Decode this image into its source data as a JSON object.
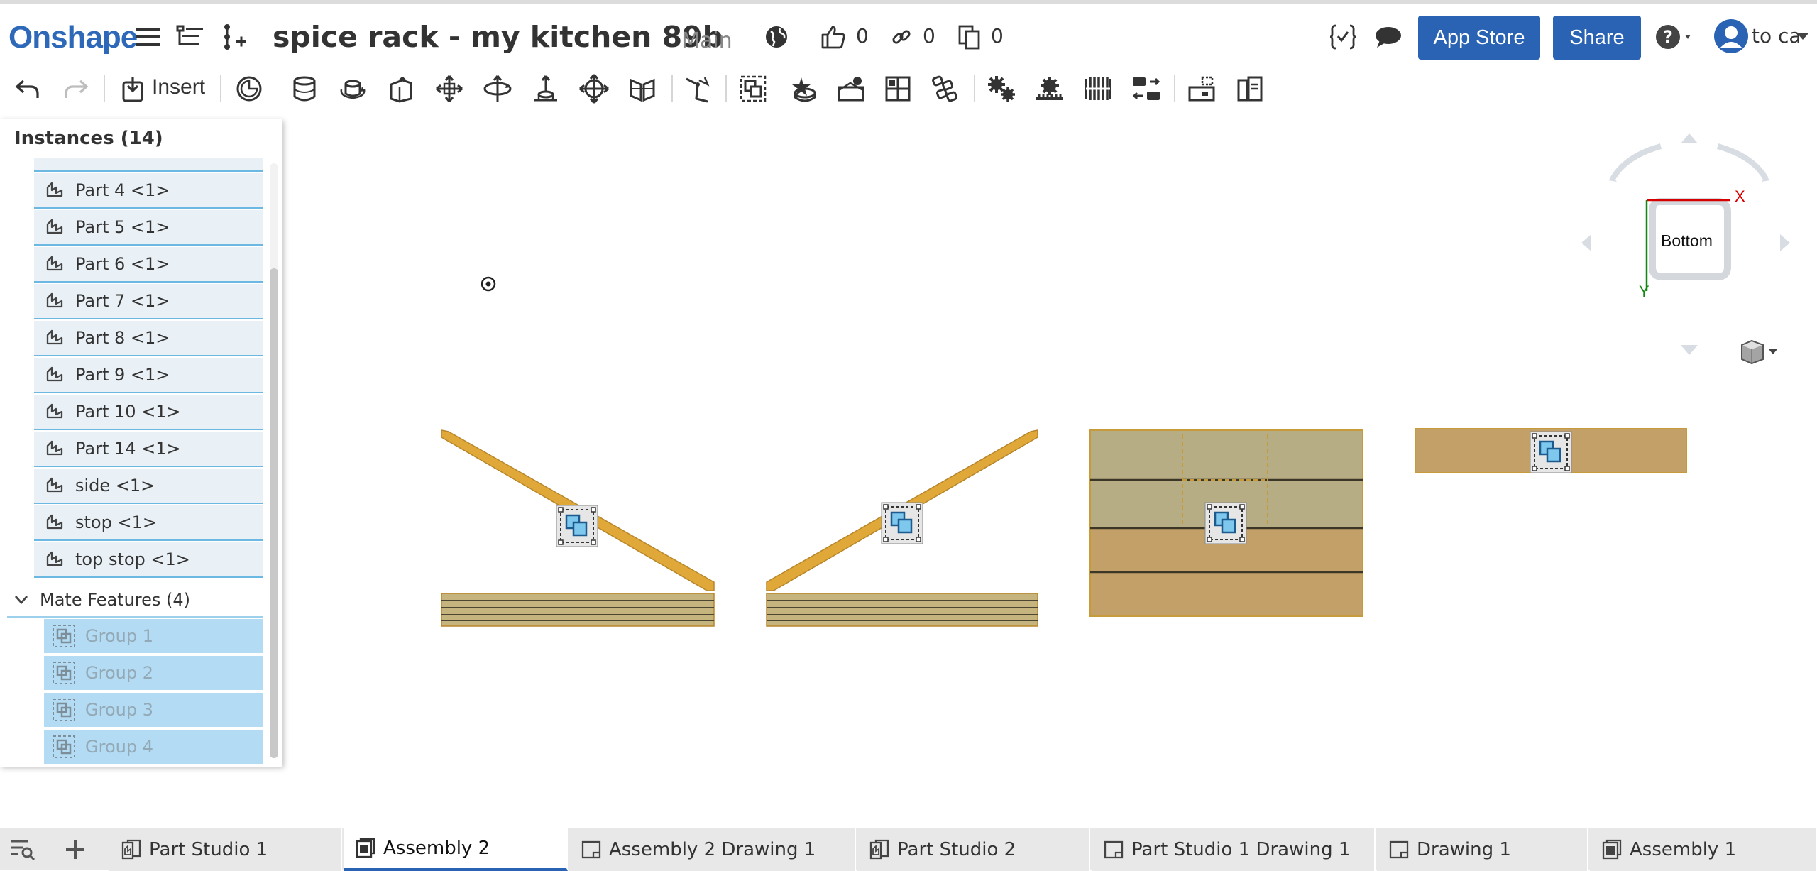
{
  "header": {
    "logo": "Onshape",
    "document_title": "spice rack - my kitchen 89b",
    "branch": "Main",
    "likes_count": "0",
    "links_count": "0",
    "copies_count": "0",
    "app_store_label": "App Store",
    "share_label": "Share",
    "user_name": "to ca"
  },
  "toolbar": {
    "insert_label": "Insert"
  },
  "panel": {
    "title": "Instances (14)",
    "instances": [
      {
        "label": "Part 4 <1>"
      },
      {
        "label": "Part 5 <1>"
      },
      {
        "label": "Part 6 <1>"
      },
      {
        "label": "Part 7 <1>"
      },
      {
        "label": "Part 8 <1>"
      },
      {
        "label": "Part 9 <1>"
      },
      {
        "label": "Part 10 <1>"
      },
      {
        "label": "Part 14 <1>"
      },
      {
        "label": "side <1>"
      },
      {
        "label": "stop <1>"
      },
      {
        "label": "top stop <1>"
      }
    ],
    "mate_features_label": "Mate Features (4)",
    "groups": [
      {
        "label": "Group 1"
      },
      {
        "label": "Group 2"
      },
      {
        "label": "Group 3"
      },
      {
        "label": "Group 4"
      }
    ]
  },
  "viewcube": {
    "face_label": "Bottom",
    "x_label": "X",
    "y_label": "Y"
  },
  "tabs": [
    {
      "label": "Part Studio 1",
      "icon": "part-studio-icon",
      "active": false
    },
    {
      "label": "Assembly 2",
      "icon": "assembly-icon",
      "active": true
    },
    {
      "label": "Assembly 2 Drawing 1",
      "icon": "drawing-icon",
      "active": false
    },
    {
      "label": "Part Studio 2",
      "icon": "part-studio-icon",
      "active": false
    },
    {
      "label": "Part Studio 1 Drawing 1",
      "icon": "drawing-icon",
      "active": false
    },
    {
      "label": "Drawing 1",
      "icon": "drawing-icon",
      "active": false
    },
    {
      "label": "Assembly 1",
      "icon": "assembly-icon",
      "active": false
    }
  ],
  "colors": {
    "brand_blue": "#2a63b3",
    "wood": "#dfa838",
    "wood_flat": "#b9a877",
    "wood_dark": "#c2a068",
    "selection_blue": "#b3dcf4"
  }
}
